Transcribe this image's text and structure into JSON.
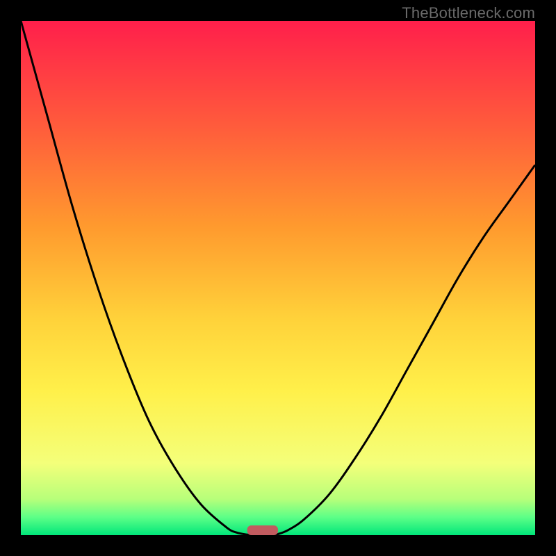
{
  "watermark": "TheBottleneck.com",
  "chart_data": {
    "type": "line",
    "title": "",
    "xlabel": "",
    "ylabel": "",
    "xlim": [
      0,
      100
    ],
    "ylim": [
      0,
      100
    ],
    "series": [
      {
        "name": "left-curve",
        "x": [
          0,
          5,
          10,
          15,
          20,
          25,
          30,
          35,
          40,
          42,
          44,
          45
        ],
        "y": [
          100,
          82,
          64,
          48,
          34,
          22,
          13,
          6,
          1.5,
          0.5,
          0.1,
          0
        ]
      },
      {
        "name": "right-curve",
        "x": [
          49,
          50,
          52,
          55,
          60,
          65,
          70,
          75,
          80,
          85,
          90,
          95,
          100
        ],
        "y": [
          0,
          0.2,
          1,
          3,
          8,
          15,
          23,
          32,
          41,
          50,
          58,
          65,
          72
        ]
      }
    ],
    "marker": {
      "x_center": 47,
      "width": 6,
      "y": 0,
      "color": "#c15b5f"
    },
    "gradient_stops": [
      {
        "offset": 0.0,
        "color": "#ff1f4b"
      },
      {
        "offset": 0.2,
        "color": "#ff5a3c"
      },
      {
        "offset": 0.4,
        "color": "#ff9a2e"
      },
      {
        "offset": 0.58,
        "color": "#ffd23a"
      },
      {
        "offset": 0.72,
        "color": "#fff04a"
      },
      {
        "offset": 0.86,
        "color": "#f4ff7a"
      },
      {
        "offset": 0.93,
        "color": "#b7ff7a"
      },
      {
        "offset": 0.965,
        "color": "#5dff87"
      },
      {
        "offset": 1.0,
        "color": "#00e67a"
      }
    ]
  }
}
